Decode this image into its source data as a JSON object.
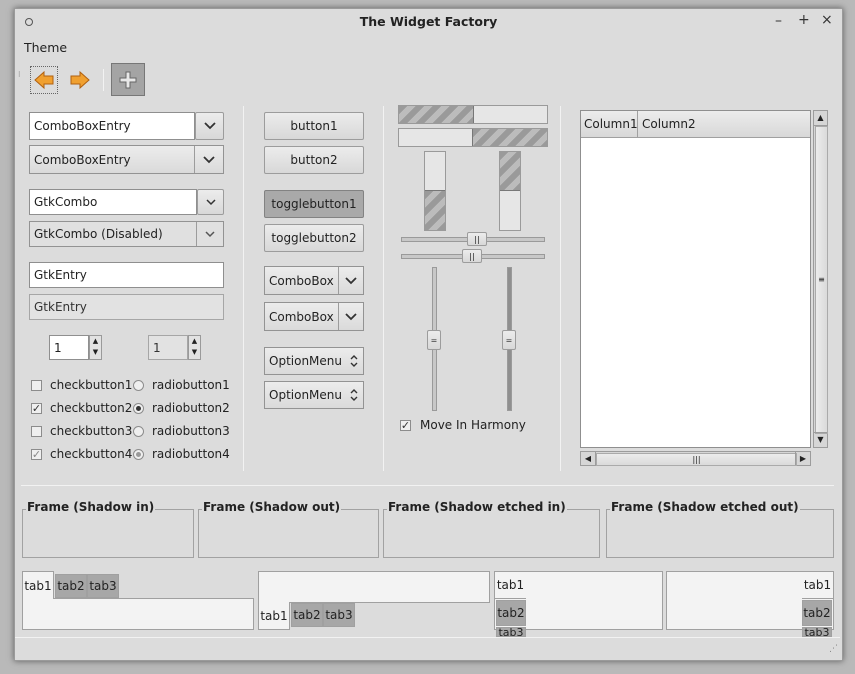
{
  "window": {
    "title": "The Widget Factory"
  },
  "menubar": {
    "theme": "Theme"
  },
  "combos": {
    "entry1": "ComboBoxEntry",
    "entry2": "ComboBoxEntry",
    "gtkcombo": "GtkCombo",
    "gtkcombo_disabled": "GtkCombo (Disabled)"
  },
  "entries": {
    "entry1": "GtkEntry",
    "entry2": "GtkEntry"
  },
  "spins": {
    "spin1": "1",
    "spin2": "1"
  },
  "checks": [
    {
      "label": "checkbutton1",
      "checked": false
    },
    {
      "label": "checkbutton2",
      "checked": true
    },
    {
      "label": "checkbutton3",
      "checked": false
    },
    {
      "label": "checkbutton4",
      "checked": true
    }
  ],
  "radios": [
    {
      "label": "radiobutton1",
      "selected": false
    },
    {
      "label": "radiobutton2",
      "selected": true
    },
    {
      "label": "radiobutton3",
      "selected": false
    },
    {
      "label": "radiobutton4",
      "selected": true
    }
  ],
  "buttons": {
    "button1": "button1",
    "button2": "button2",
    "toggle1": "togglebutton1",
    "toggle2": "togglebutton2",
    "combobox1": "ComboBox",
    "combobox2": "ComboBox",
    "option1": "OptionMenu",
    "option2": "OptionMenu"
  },
  "harmony": {
    "label": "Move In Harmony",
    "checked": true
  },
  "tree": {
    "col1": "Column1",
    "col2": "Column2"
  },
  "frames": {
    "in": "Frame (Shadow in)",
    "out": "Frame (Shadow out)",
    "etched_in": "Frame (Shadow etched in)",
    "etched_out": "Frame (Shadow etched out)"
  },
  "tabs": {
    "t1": "tab1",
    "t2": "tab2",
    "t3": "tab3",
    "t3_partial": "tab3"
  },
  "icons": {
    "back": "arrow-left-icon",
    "forward": "arrow-right-icon",
    "add": "plus-icon"
  }
}
